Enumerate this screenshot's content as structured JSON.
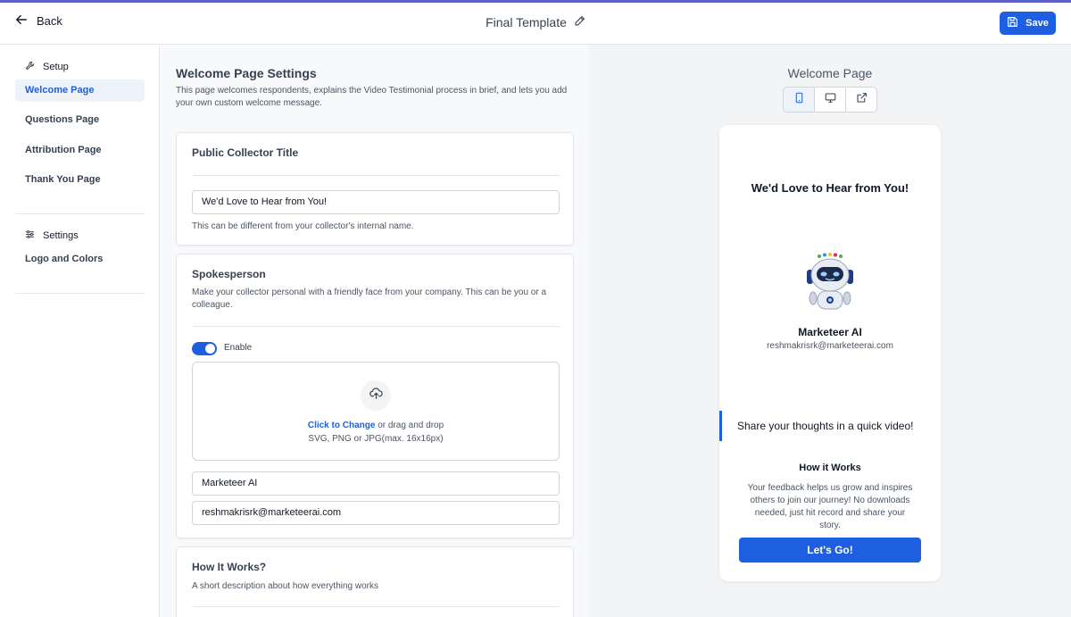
{
  "colors": {
    "accent": "#1d5fe0",
    "top_bar": "#5b5fc7"
  },
  "header": {
    "back_label": "Back",
    "title": "Final Template",
    "save_label": "Save"
  },
  "sidebar": {
    "setup_heading": "Setup",
    "setup_items": [
      {
        "label": "Welcome Page",
        "active": true
      },
      {
        "label": "Questions Page",
        "active": false
      },
      {
        "label": "Attribution Page",
        "active": false
      },
      {
        "label": "Thank You Page",
        "active": false
      }
    ],
    "settings_heading": "Settings",
    "settings_items": [
      {
        "label": "Logo and Colors",
        "active": false
      }
    ]
  },
  "settings": {
    "title": "Welcome Page Settings",
    "subtitle": "This page welcomes respondents, explains the Video Testimonial process in brief, and lets you add your own custom welcome message.",
    "public_title": {
      "heading": "Public Collector Title",
      "value": "We'd Love to Hear from You!",
      "helper": "This can be different from your collector's internal name."
    },
    "spokesperson": {
      "heading": "Spokesperson",
      "description": "Make your collector personal with a friendly face from your company. This can be you or a colleague.",
      "enable_label": "Enable",
      "enabled": true,
      "upload_link": "Click to Change",
      "upload_text": " or drag and drop",
      "upload_hint": "SVG, PNG or JPG(max. 16x16px)",
      "name_value": "Marketeer AI",
      "email_value": "reshmakrisrk@marketeerai.com"
    },
    "how_it_works": {
      "heading": "How It Works?",
      "description": "A short description about how everything works"
    }
  },
  "preview": {
    "title": "Welcome Page",
    "view_icons": [
      "mobile-icon",
      "desktop-icon",
      "external-link-icon"
    ],
    "heading": "We'd Love to Hear from You!",
    "name": "Marketeer AI",
    "email": "reshmakrisrk@marketeerai.com",
    "share_text": "Share your thoughts in a quick video!",
    "how_title": "How it Works",
    "how_text": "Your feedback helps us grow and inspires others to join our journey! No downloads needed, just hit record and share your story.",
    "cta_label": "Let's Go!"
  }
}
